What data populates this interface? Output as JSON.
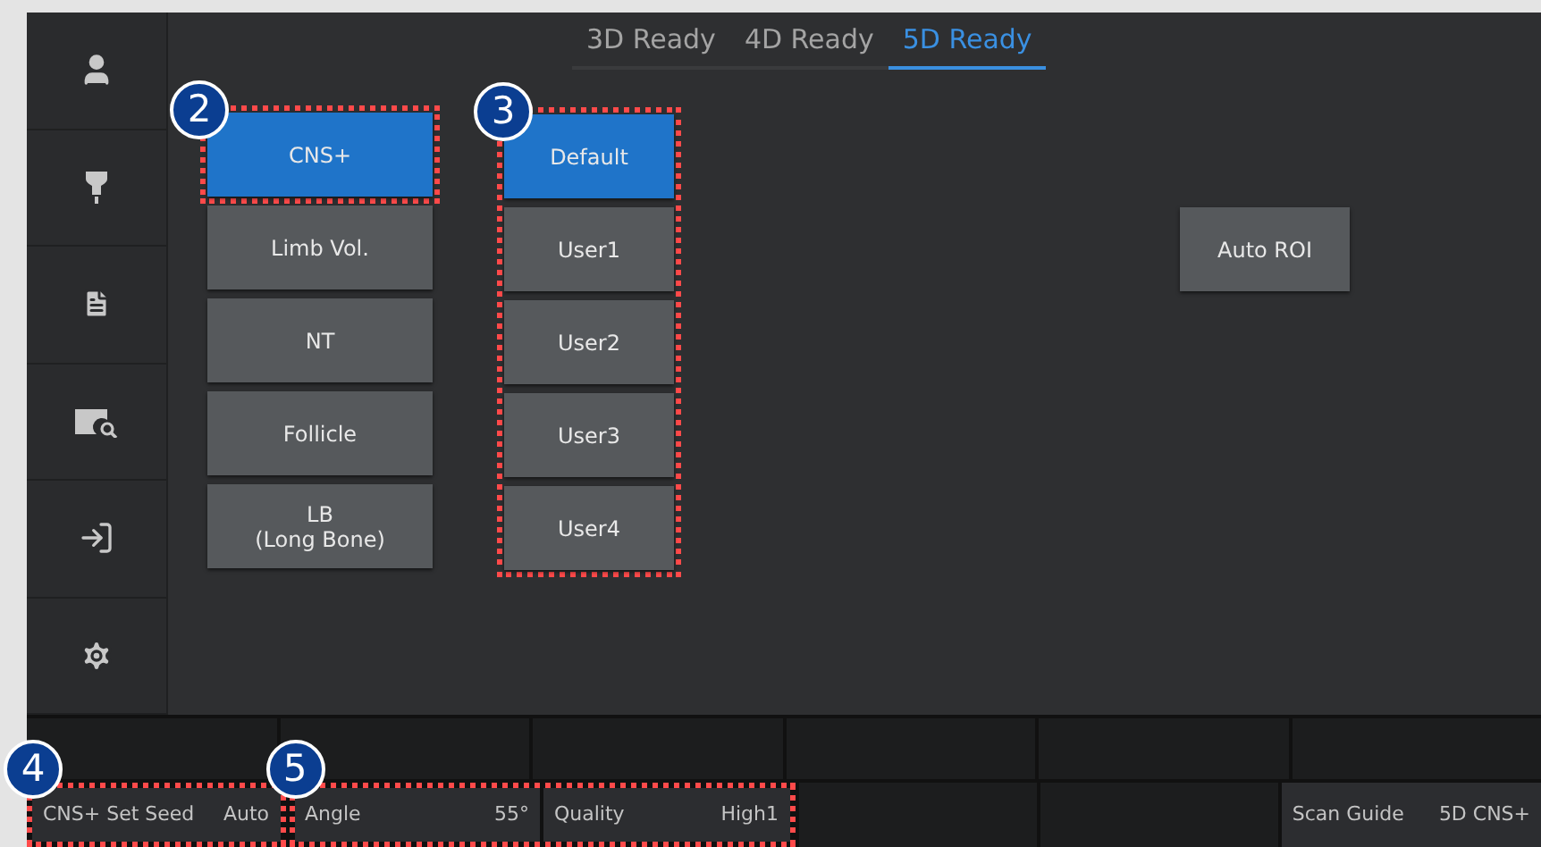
{
  "tabs": [
    {
      "label": "3D Ready",
      "selected": false
    },
    {
      "label": "4D Ready",
      "selected": false
    },
    {
      "label": "5D Ready",
      "selected": true
    }
  ],
  "sidebar": {
    "items": [
      {
        "kind": "user"
      },
      {
        "kind": "probe"
      },
      {
        "kind": "report"
      },
      {
        "kind": "review"
      },
      {
        "kind": "exit"
      },
      {
        "kind": "settings"
      }
    ]
  },
  "presets": {
    "callout": "2",
    "items": [
      {
        "label": "CNS+",
        "selected": true
      },
      {
        "label": "Limb Vol.",
        "selected": false
      },
      {
        "label": "NT",
        "selected": false
      },
      {
        "label": "Follicle",
        "selected": false
      },
      {
        "label": "LB\n(Long Bone)",
        "selected": false
      }
    ]
  },
  "user_settings": {
    "callout": "3",
    "items": [
      {
        "label": "Default",
        "selected": true
      },
      {
        "label": "User1",
        "selected": false
      },
      {
        "label": "User2",
        "selected": false
      },
      {
        "label": "User3",
        "selected": false
      },
      {
        "label": "User4",
        "selected": false
      }
    ]
  },
  "auto_roi": {
    "label": "Auto ROI"
  },
  "bottom_bar": {
    "groups": [
      {
        "callout": "4",
        "cells": [
          {
            "kind": "setting",
            "label": "CNS+ Set Seed",
            "value": "Auto"
          }
        ]
      },
      {
        "callout": "5",
        "cells": [
          {
            "kind": "setting",
            "label": "Angle",
            "value": "55°"
          },
          {
            "kind": "setting",
            "label": "Quality",
            "value": "High1"
          }
        ]
      },
      {
        "cells": [
          {
            "kind": "empty"
          },
          {
            "kind": "empty"
          },
          {
            "kind": "setting",
            "label": "Scan Guide",
            "value": "5D CNS+"
          }
        ]
      }
    ]
  }
}
